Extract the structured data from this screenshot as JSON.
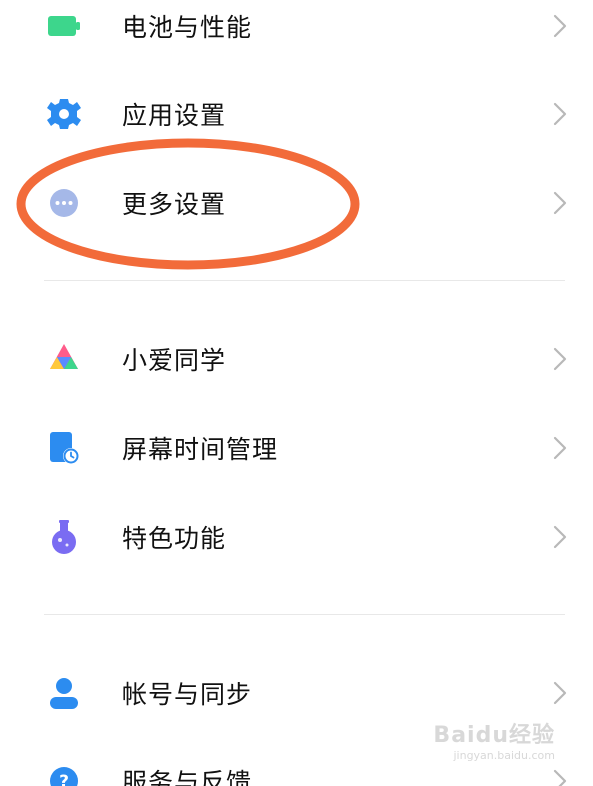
{
  "settings": {
    "group1": [
      {
        "label": "电池与性能",
        "icon": "battery-icon"
      },
      {
        "label": "应用设置",
        "icon": "gear-icon"
      },
      {
        "label": "更多设置",
        "icon": "more-dots-icon"
      }
    ],
    "group2": [
      {
        "label": "小爱同学",
        "icon": "xiaoai-icon"
      },
      {
        "label": "屏幕时间管理",
        "icon": "screen-time-icon"
      },
      {
        "label": "特色功能",
        "icon": "flask-icon"
      }
    ],
    "group3": [
      {
        "label": "帐号与同步",
        "icon": "person-icon"
      },
      {
        "label": "服务与反馈",
        "icon": "help-icon"
      }
    ]
  },
  "annotation": {
    "highlight_color": "#F26B3A",
    "highlighted_item": "更多设置"
  },
  "watermark": {
    "main": "Baidu经验",
    "sub": "jingyan.baidu.com"
  },
  "colors": {
    "battery": "#3DD68C",
    "gear": "#2C8CF0",
    "more": "#A5B8E8",
    "screen_time": "#2C8CF0",
    "flask": "#7A6CF2",
    "person": "#2C8CF0",
    "help": "#2C8CF0",
    "chevron": "#B8B8B8"
  }
}
